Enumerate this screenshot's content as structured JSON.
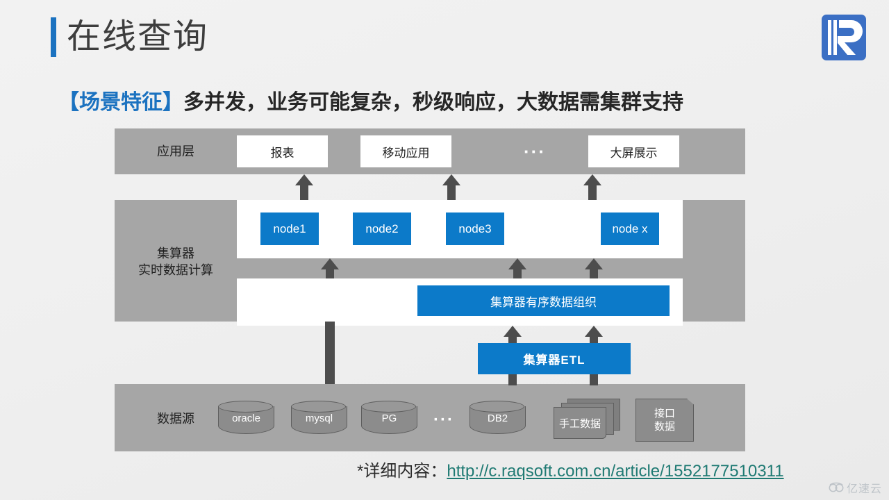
{
  "header": {
    "title": "在线查询",
    "accent_color": "#1b72c0",
    "logo_name": "raqsoft-logo"
  },
  "subtitle": {
    "tag": "【场景特征】",
    "text": "多并发，业务可能复杂，秒级响应，大数据需集群支持",
    "tag_color": "#1b72c0"
  },
  "diagram": {
    "band_color": "#a6a6a6",
    "accent_blue": "#0c7ac9",
    "arrow_color": "#4d4d4d",
    "layers": [
      {
        "label": "应用层"
      },
      {
        "label": "集算器\n实时数据计算",
        "label_line1": "集算器",
        "label_line2": "实时数据计算"
      },
      {
        "label": "数据源"
      }
    ],
    "app_boxes": [
      {
        "label": "报表"
      },
      {
        "label": "移动应用"
      },
      {
        "label": "大屏展示"
      }
    ],
    "app_ellipsis": "···",
    "nodes": [
      {
        "label": "node1"
      },
      {
        "label": "node2"
      },
      {
        "label": "node3"
      },
      {
        "label": "node x"
      }
    ],
    "ordered_data_bar": "集算器有序数据组织",
    "etl_box": "集算器ETL",
    "data_sources": {
      "cylinders": [
        {
          "label": "oracle"
        },
        {
          "label": "mysql"
        },
        {
          "label": "PG"
        },
        {
          "label": "DB2"
        }
      ],
      "ellipsis": "···",
      "stacked_docs": "手工数据",
      "interface_box_line1": "接口",
      "interface_box_line2": "数据"
    }
  },
  "footer": {
    "prefix": "*详细内容：",
    "link_text": "http://c.raqsoft.com.cn/article/1552177510311",
    "link_color": "#1f7a73"
  },
  "watermark": {
    "text": "亿速云",
    "icon_name": "cloud-icon"
  }
}
